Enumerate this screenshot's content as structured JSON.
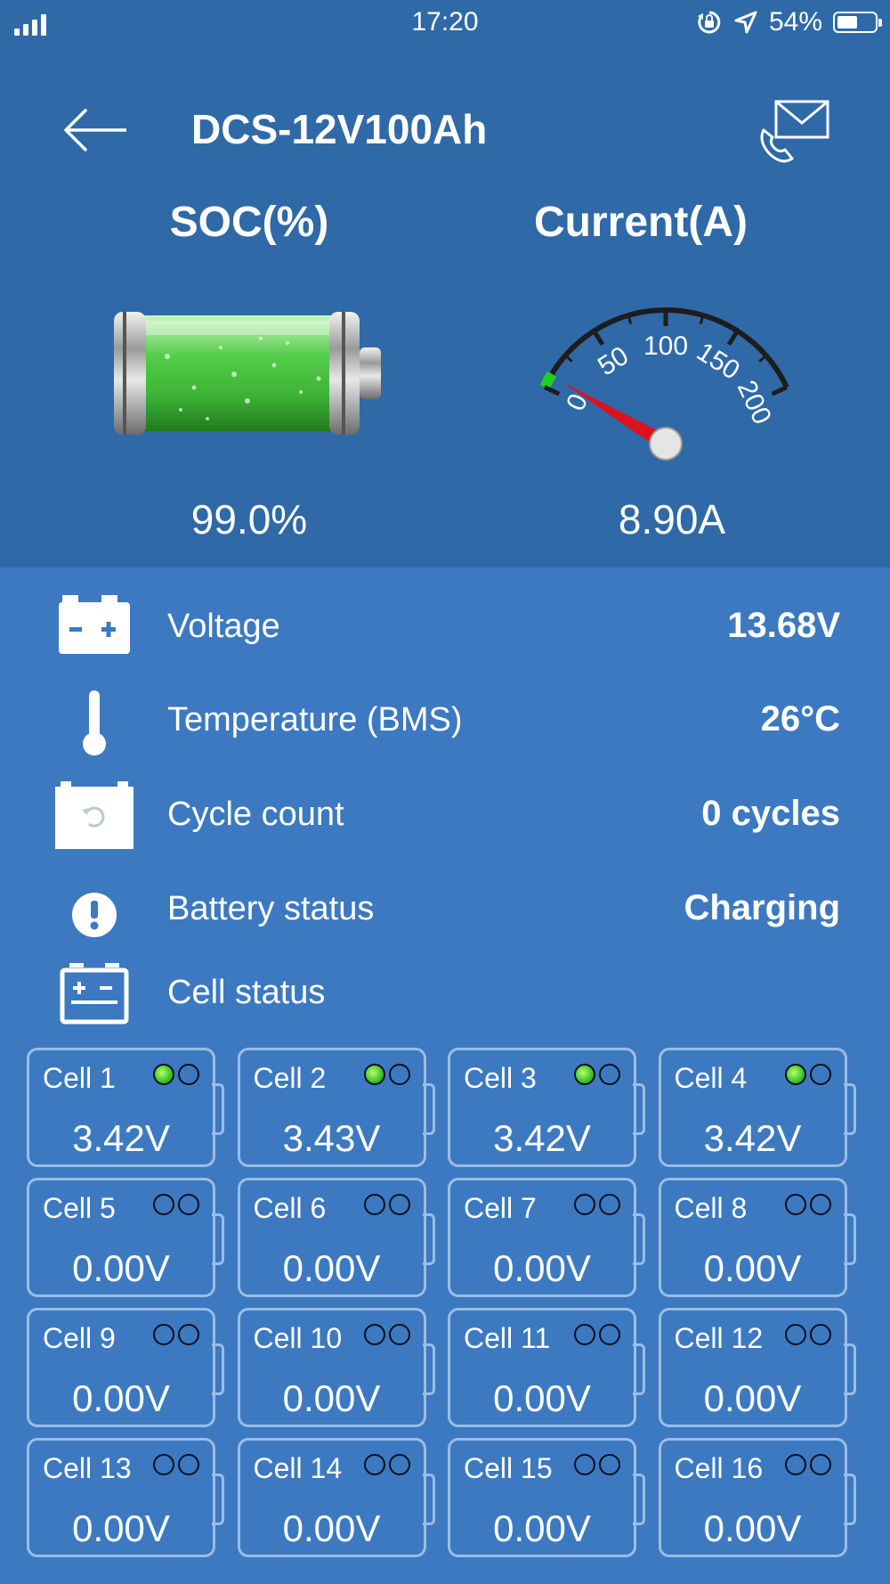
{
  "status_bar": {
    "time": "17:20",
    "battery_percent": "54%",
    "battery_level": 0.54
  },
  "header": {
    "title": "DCS-12V100Ah"
  },
  "soc": {
    "label": "SOC(%)",
    "value": "99.0%",
    "level": 0.99
  },
  "current": {
    "label": "Current(A)",
    "value": "8.90A",
    "reading": 8.9,
    "gauge_ticks": [
      "0",
      "50",
      "100",
      "150",
      "200"
    ],
    "gauge_max": 200
  },
  "metrics": [
    {
      "label": "Voltage",
      "value": "13.68V",
      "icon": "battery-plus-minus-icon"
    },
    {
      "label": "Temperature (BMS)",
      "value": "26°C",
      "icon": "thermometer-icon"
    },
    {
      "label": "Cycle count",
      "value": "0 cycles",
      "icon": "battery-cycle-icon"
    },
    {
      "label": "Battery status",
      "value": "Charging",
      "icon": "exclamation-icon"
    },
    {
      "label": "Cell status",
      "value": "",
      "icon": "battery-cell-icon"
    }
  ],
  "cells": [
    {
      "name": "Cell 1",
      "voltage": "3.42V",
      "balancing": true
    },
    {
      "name": "Cell 2",
      "voltage": "3.43V",
      "balancing": true
    },
    {
      "name": "Cell 3",
      "voltage": "3.42V",
      "balancing": true
    },
    {
      "name": "Cell 4",
      "voltage": "3.42V",
      "balancing": true
    },
    {
      "name": "Cell 5",
      "voltage": "0.00V",
      "balancing": false
    },
    {
      "name": "Cell 6",
      "voltage": "0.00V",
      "balancing": false
    },
    {
      "name": "Cell 7",
      "voltage": "0.00V",
      "balancing": false
    },
    {
      "name": "Cell 8",
      "voltage": "0.00V",
      "balancing": false
    },
    {
      "name": "Cell 9",
      "voltage": "0.00V",
      "balancing": false
    },
    {
      "name": "Cell 10",
      "voltage": "0.00V",
      "balancing": false
    },
    {
      "name": "Cell 11",
      "voltage": "0.00V",
      "balancing": false
    },
    {
      "name": "Cell 12",
      "voltage": "0.00V",
      "balancing": false
    },
    {
      "name": "Cell 13",
      "voltage": "0.00V",
      "balancing": false
    },
    {
      "name": "Cell 14",
      "voltage": "0.00V",
      "balancing": false
    },
    {
      "name": "Cell 15",
      "voltage": "0.00V",
      "balancing": false
    },
    {
      "name": "Cell 16",
      "voltage": "0.00V",
      "balancing": false
    }
  ],
  "colors": {
    "header_bg": "#2f69a7",
    "body_bg": "#3c79c1",
    "led_on": "#3cc228",
    "needle": "#d8141f"
  }
}
